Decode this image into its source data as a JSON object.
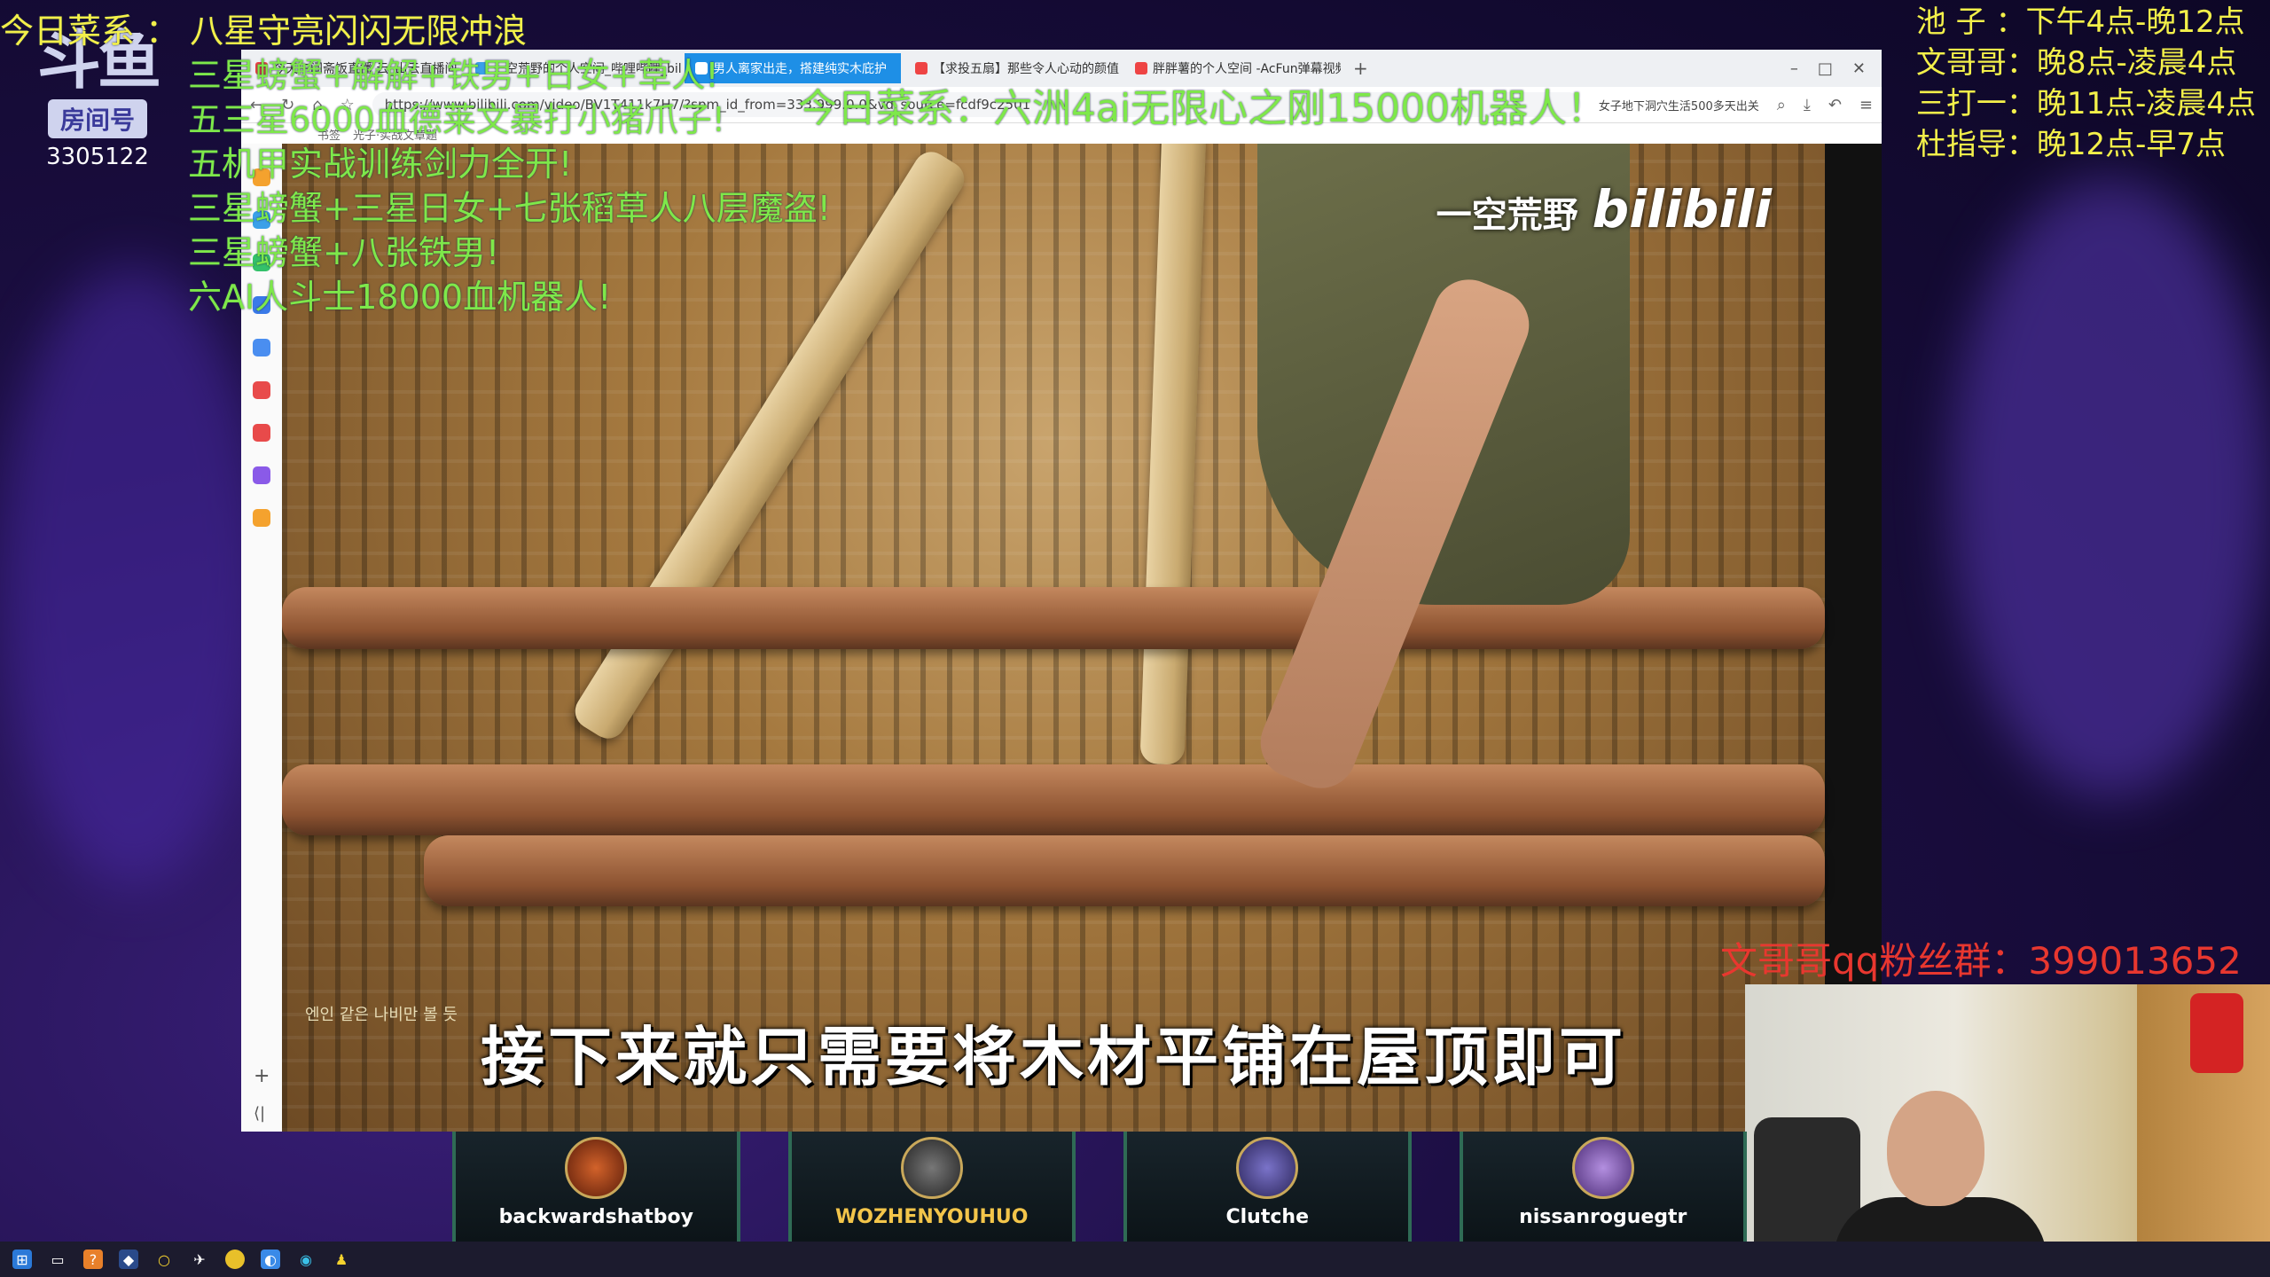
{
  "stream": {
    "room_label": "房间号",
    "room_id": "3305122",
    "platform": "斗鱼",
    "title_line": "今日菜系 ： 八星守亮闪闪无限冲浪",
    "menu_lines": [
      "三星螃蟹+解解+铁男+日女+草人!",
      "五三星6000血德莱文暴打小猪爪子!",
      "五机甲实战训练剑力全开!",
      "三星螃蟹+三星日女+七张稻草人八层魔盗!",
      "三星螃蟹+八张铁男!",
      "六AI人斗士18000血机器人!"
    ],
    "ticker": "今日菜系：六洲4ai无限心之刚15000机器人！",
    "schedule": [
      "池  子 ：下午4点-晚12点",
      "文哥哥：晚8点-凌晨4点",
      "三打一：晚11点-凌晨4点",
      "杜指导：晚12点-早7点"
    ],
    "fan_group": "文哥哥qq粉丝群：399013652"
  },
  "browser": {
    "tabs": [
      {
        "label": "今天午间斋饭直播 云_山云直播间",
        "active": false
      },
      {
        "label": "一空荒野的个人空间_哔哩哔哩_bilibili",
        "active": false
      },
      {
        "label": "男人离家出走，搭建纯实木庇护",
        "active": true
      },
      {
        "label": "【求投五扇】那些令人心动的颜值",
        "active": false
      },
      {
        "label": "胖胖薯的个人空间 -AcFun弹幕视频",
        "active": false
      }
    ],
    "url": "https://www.bilibili.com/video/BV1T411k7H7/?spm_id_from=333.999.0.0&vd_source=fcdf9c2501",
    "search_hint": "女子地下洞穴生活500多天出关",
    "bookmarks": [
      "书签",
      "光子·实战文章题"
    ],
    "window_controls": [
      "–",
      "□",
      "✕"
    ]
  },
  "video": {
    "watermark_channel": "一空荒野",
    "watermark_brand": "bilibili",
    "subtitle": "接下来就只需要将木材平铺在屋顶即可",
    "korean_subtitle": "엔인 같은 나비만 볼 듯"
  },
  "players": [
    {
      "name": "backwardshatboy"
    },
    {
      "name": "WOZHENYOUHUO"
    },
    {
      "name": "Clutche"
    },
    {
      "name": "nissanroguegtr"
    }
  ],
  "colors": {
    "green_text": "#7ee84a",
    "yellow_text": "#f3f04a",
    "red_text": "#e8372f",
    "active_tab": "#1e8fe6"
  }
}
